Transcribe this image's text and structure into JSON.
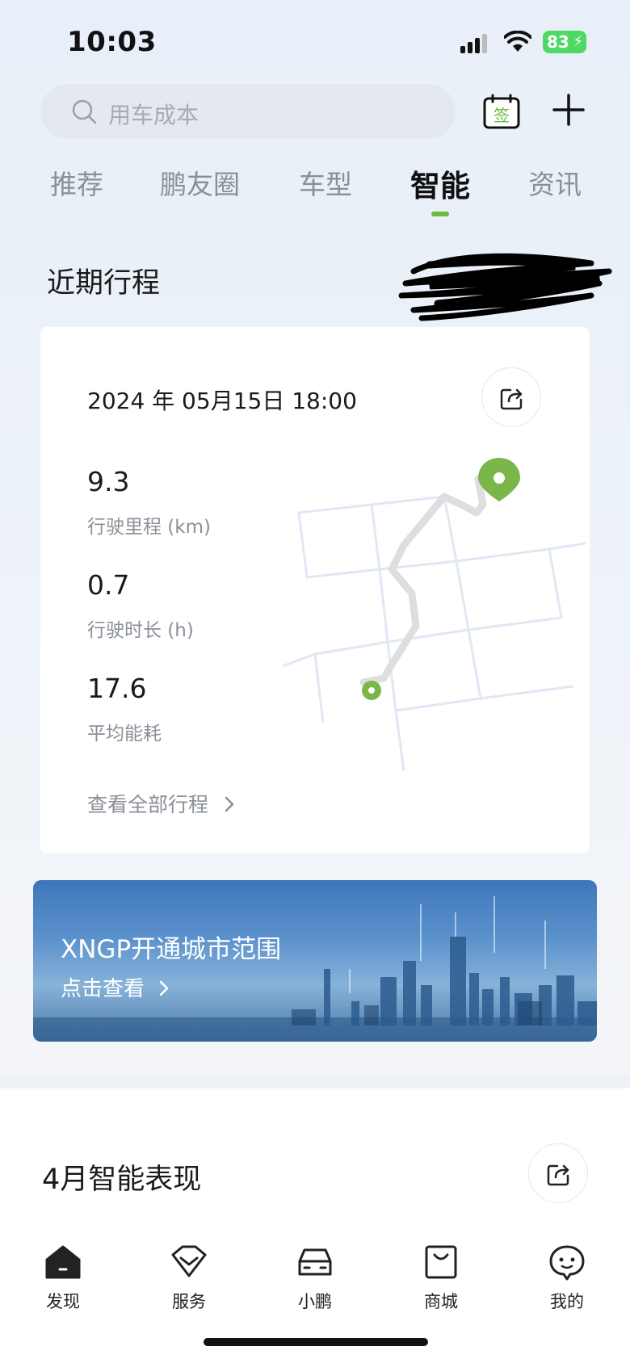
{
  "status_bar": {
    "time": "10:03",
    "battery": "83"
  },
  "search": {
    "placeholder": "用车成本"
  },
  "header": {
    "calendar_label": "签"
  },
  "tabs": [
    {
      "label": "推荐"
    },
    {
      "label": "鹏友圈"
    },
    {
      "label": "车型"
    },
    {
      "label": "智能",
      "active": true
    },
    {
      "label": "资讯"
    }
  ],
  "recent_trips": {
    "title": "近期行程",
    "date": "2024 年 05月15日 18:00",
    "stats": [
      {
        "value": "9.3",
        "label": "行驶里程 (km)"
      },
      {
        "value": "0.7",
        "label": "行驶时长 (h)"
      },
      {
        "value": "17.6",
        "label": "平均能耗"
      }
    ],
    "view_all": "查看全部行程"
  },
  "banner": {
    "title": "XNGP开通城市范围",
    "subtitle": "点击查看"
  },
  "monthly": {
    "title": "4月智能表现"
  },
  "bottom_nav": [
    {
      "label": "发现",
      "icon": "home-icon",
      "active": true
    },
    {
      "label": "服务",
      "icon": "service-icon"
    },
    {
      "label": "小鹏",
      "icon": "car-icon"
    },
    {
      "label": "商城",
      "icon": "shop-icon"
    },
    {
      "label": "我的",
      "icon": "profile-icon"
    }
  ],
  "colors": {
    "accent": "#6cbb3c",
    "pin": "#7ab648"
  }
}
